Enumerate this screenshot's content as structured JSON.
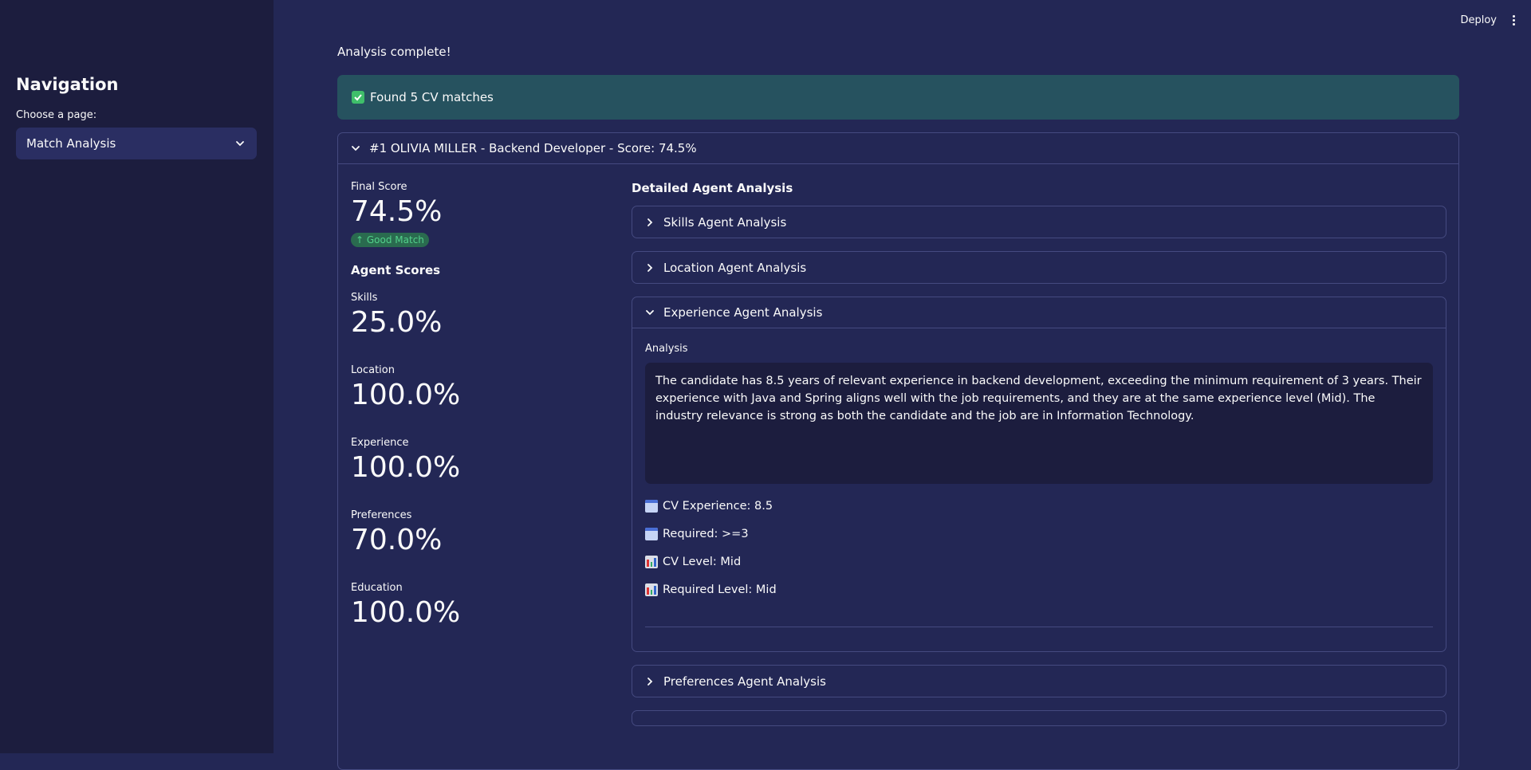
{
  "sidebar": {
    "title": "Navigation",
    "select_label": "Choose a page:",
    "selected_page": "Match Analysis"
  },
  "toolbar": {
    "deploy_label": "Deploy"
  },
  "main": {
    "status_text": "Analysis complete!",
    "success_message": "Found 5 CV matches",
    "expander_title": "#1 OLIVIA MILLER - Backend Developer - Score: 74.5%",
    "final_score": {
      "label": "Final Score",
      "value": "74.5%",
      "delta": "Good Match"
    },
    "agent_scores_title": "Agent Scores",
    "agent_scores": [
      {
        "label": "Skills",
        "value": "25.0%"
      },
      {
        "label": "Location",
        "value": "100.0%"
      },
      {
        "label": "Experience",
        "value": "100.0%"
      },
      {
        "label": "Preferences",
        "value": "70.0%"
      },
      {
        "label": "Education",
        "value": "100.0%"
      }
    ],
    "detailed_title": "Detailed Agent Analysis",
    "agents": [
      {
        "label": "Skills Agent Analysis"
      },
      {
        "label": "Location Agent Analysis"
      },
      {
        "label": "Experience Agent Analysis"
      },
      {
        "label": "Preferences Agent Analysis"
      }
    ],
    "experience": {
      "analysis_label": "Analysis",
      "analysis_text": "The candidate has 8.5 years of relevant experience in backend development, exceeding the minimum requirement of 3 years. Their experience with Java and Spring aligns well with the job requirements, and they are at the same experience level (Mid). The industry relevance is strong as both the candidate and the job are in Information Technology.",
      "cv_experience": "CV Experience: 8.5",
      "required": "Required: >=3",
      "cv_level": "CV Level: Mid",
      "required_level": "Required Level: Mid"
    }
  },
  "colors": {
    "background": "#232755",
    "sidebar": "#1c1d3e",
    "success_bg": "#26525f",
    "badge_green": "#52d18b"
  }
}
